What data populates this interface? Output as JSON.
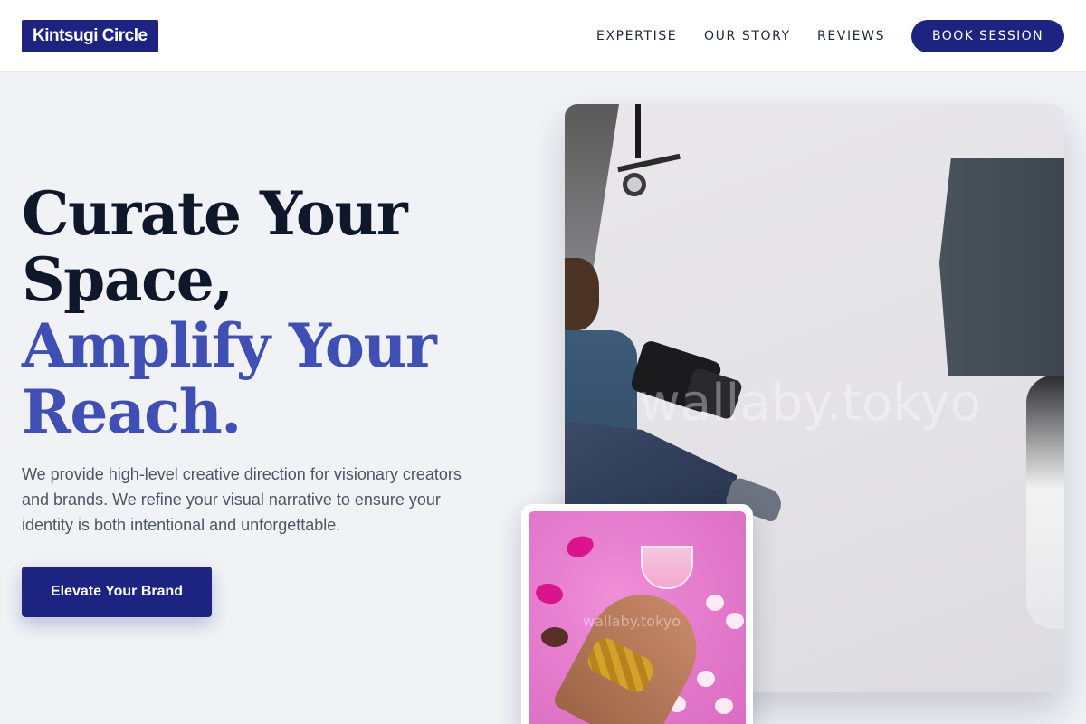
{
  "header": {
    "logo_text": "Kintsugi Circle",
    "nav": {
      "expertise": "EXPERTISE",
      "our_story": "OUR STORY",
      "reviews": "REVIEWS"
    },
    "book_label": "BOOK SESSION"
  },
  "hero": {
    "headline_line1": "Curate Your",
    "headline_line2": "Space,",
    "headline_line3": "Amplify Your",
    "headline_line4": "Reach.",
    "subcopy": "We provide high-level creative direction for visionary creators and brands. We refine your visual narrative to ensure your identity is both intentional and unforgettable.",
    "cta_label": "Elevate Your Brand"
  },
  "media": {
    "main_watermark": "wallaby.tokyo",
    "inset_watermark": "wallaby.tokyo"
  },
  "colors": {
    "brand": "#1c2380",
    "accent": "#3f4fb4",
    "page_bg": "#f0f2f6"
  }
}
